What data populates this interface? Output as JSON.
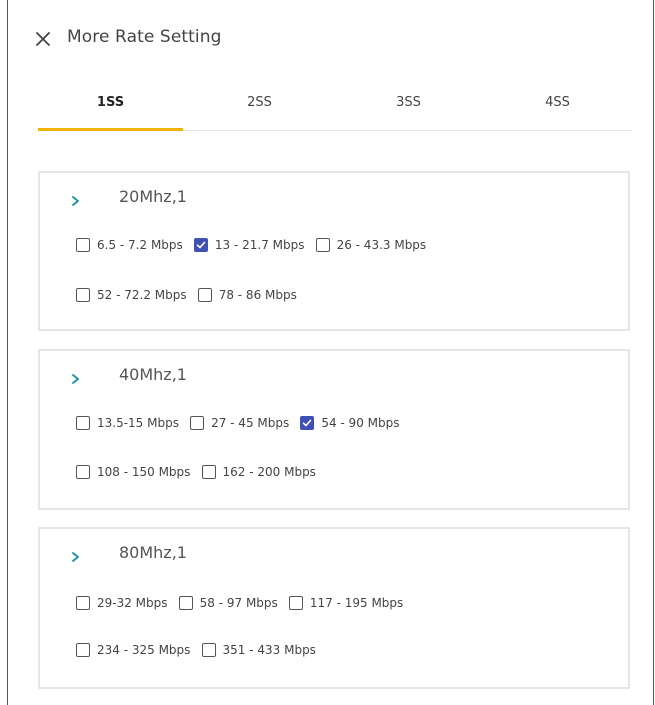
{
  "dialog": {
    "title": "More Rate Setting"
  },
  "tabs": [
    "1SS",
    "2SS",
    "3SS",
    "4SS"
  ],
  "active_tab": "1SS",
  "accent_color": "#f0b400",
  "checkbox_color": "#3f51b5",
  "groups": [
    {
      "title": "20Mhz,1",
      "options": [
        {
          "label": "6.5 - 7.2 Mbps",
          "checked": false
        },
        {
          "label": "13 - 21.7 Mbps",
          "checked": true
        },
        {
          "label": "26 - 43.3 Mbps",
          "checked": false
        },
        {
          "label": "52 - 72.2 Mbps",
          "checked": false
        },
        {
          "label": "78 - 86 Mbps",
          "checked": false
        }
      ]
    },
    {
      "title": "40Mhz,1",
      "options": [
        {
          "label": "13.5-15 Mbps",
          "checked": false
        },
        {
          "label": "27 - 45 Mbps",
          "checked": false
        },
        {
          "label": "54 - 90 Mbps",
          "checked": true
        },
        {
          "label": "108 - 150 Mbps",
          "checked": false
        },
        {
          "label": "162 - 200 Mbps",
          "checked": false
        }
      ]
    },
    {
      "title": "80Mhz,1",
      "options": [
        {
          "label": "29-32 Mbps",
          "checked": false
        },
        {
          "label": "58 - 97 Mbps",
          "checked": false
        },
        {
          "label": "117 - 195 Mbps",
          "checked": false
        },
        {
          "label": "234 - 325 Mbps",
          "checked": false
        },
        {
          "label": "351 - 433 Mbps",
          "checked": false
        }
      ]
    }
  ]
}
